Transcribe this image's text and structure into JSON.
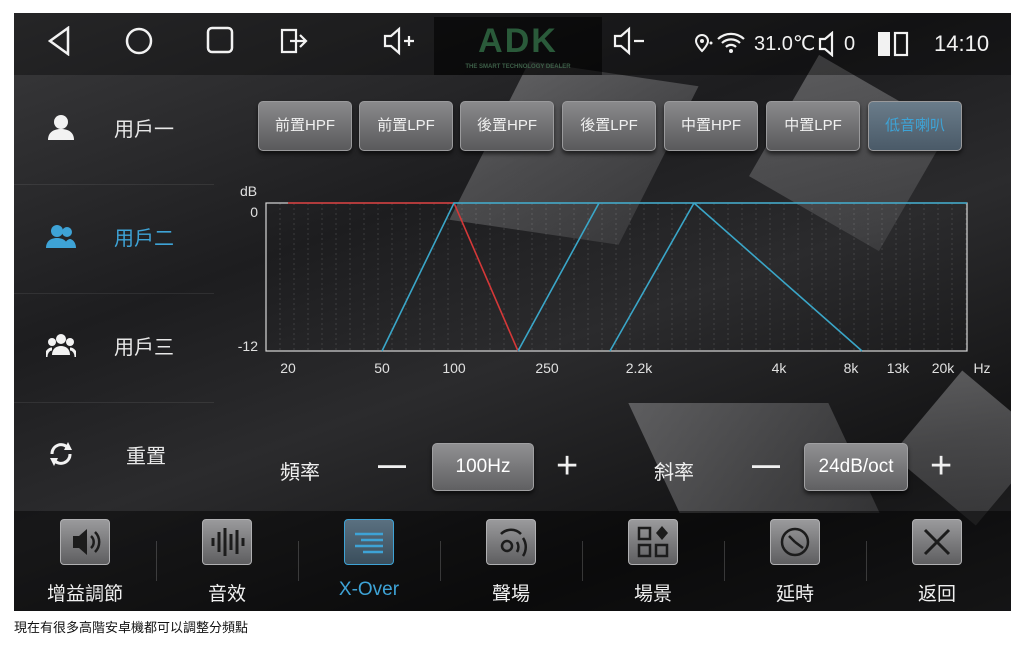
{
  "status_bar": {
    "temperature": "31.0℃",
    "volume_level": "0",
    "time": "14:10",
    "logo_text": "ADK",
    "logo_subtext": "THE SMART TECHNOLOGY DEALER"
  },
  "sidebar": {
    "users": [
      {
        "label": "用戶一",
        "active": false
      },
      {
        "label": "用戶二",
        "active": true
      },
      {
        "label": "用戶三",
        "active": false
      }
    ],
    "reset_label": "重置"
  },
  "filter_tabs": [
    {
      "label": "前置HPF",
      "active": false
    },
    {
      "label": "前置LPF",
      "active": false
    },
    {
      "label": "後置HPF",
      "active": false
    },
    {
      "label": "後置LPF",
      "active": false
    },
    {
      "label": "中置HPF",
      "active": false
    },
    {
      "label": "中置LPF",
      "active": false
    },
    {
      "label": "低音喇叭",
      "active": true
    }
  ],
  "chart_data": {
    "type": "line",
    "ylabel": "dB",
    "y_ticks": [
      "0",
      "-12"
    ],
    "ylim": [
      -12,
      0
    ],
    "x_unit": "Hz",
    "x_ticks": [
      "20",
      "50",
      "100",
      "250",
      "2.2k",
      "4k",
      "8k",
      "13k",
      "20k"
    ],
    "series": [
      {
        "color": "#d43838",
        "points": [
          [
            20,
            0
          ],
          [
            100,
            0
          ],
          [
            250,
            -12
          ]
        ]
      },
      {
        "color": "#3aa6c8",
        "points": [
          [
            50,
            -12
          ],
          [
            100,
            0
          ],
          [
            20000,
            0
          ]
        ]
      },
      {
        "color": "#3aa6c8",
        "points": [
          [
            250,
            -12
          ],
          [
            600,
            0
          ]
        ]
      },
      {
        "color": "#3aa6c8",
        "points": [
          [
            2200,
            -12
          ],
          [
            3000,
            0
          ]
        ]
      },
      {
        "color": "#3aa6c8",
        "points": [
          [
            3000,
            0
          ],
          [
            8000,
            -12
          ]
        ]
      }
    ]
  },
  "controls": {
    "frequency_label": "頻率",
    "frequency_value": "100Hz",
    "slope_label": "斜率",
    "slope_value": "24dB/oct",
    "minus": "—",
    "plus": "+"
  },
  "bottom_nav": [
    {
      "label": "增益調節",
      "icon": "speaker-icon",
      "active": false
    },
    {
      "label": "音效",
      "icon": "equalizer-icon",
      "active": false
    },
    {
      "label": "X-Over",
      "icon": "crossover-icon",
      "active": true
    },
    {
      "label": "聲場",
      "icon": "soundfield-icon",
      "active": false
    },
    {
      "label": "場景",
      "icon": "scene-icon",
      "active": false
    },
    {
      "label": "延時",
      "icon": "delay-icon",
      "active": false
    },
    {
      "label": "返回",
      "icon": "back-x-icon",
      "active": false
    }
  ],
  "caption": "現在有很多高階安卓機都可以調整分頻點"
}
